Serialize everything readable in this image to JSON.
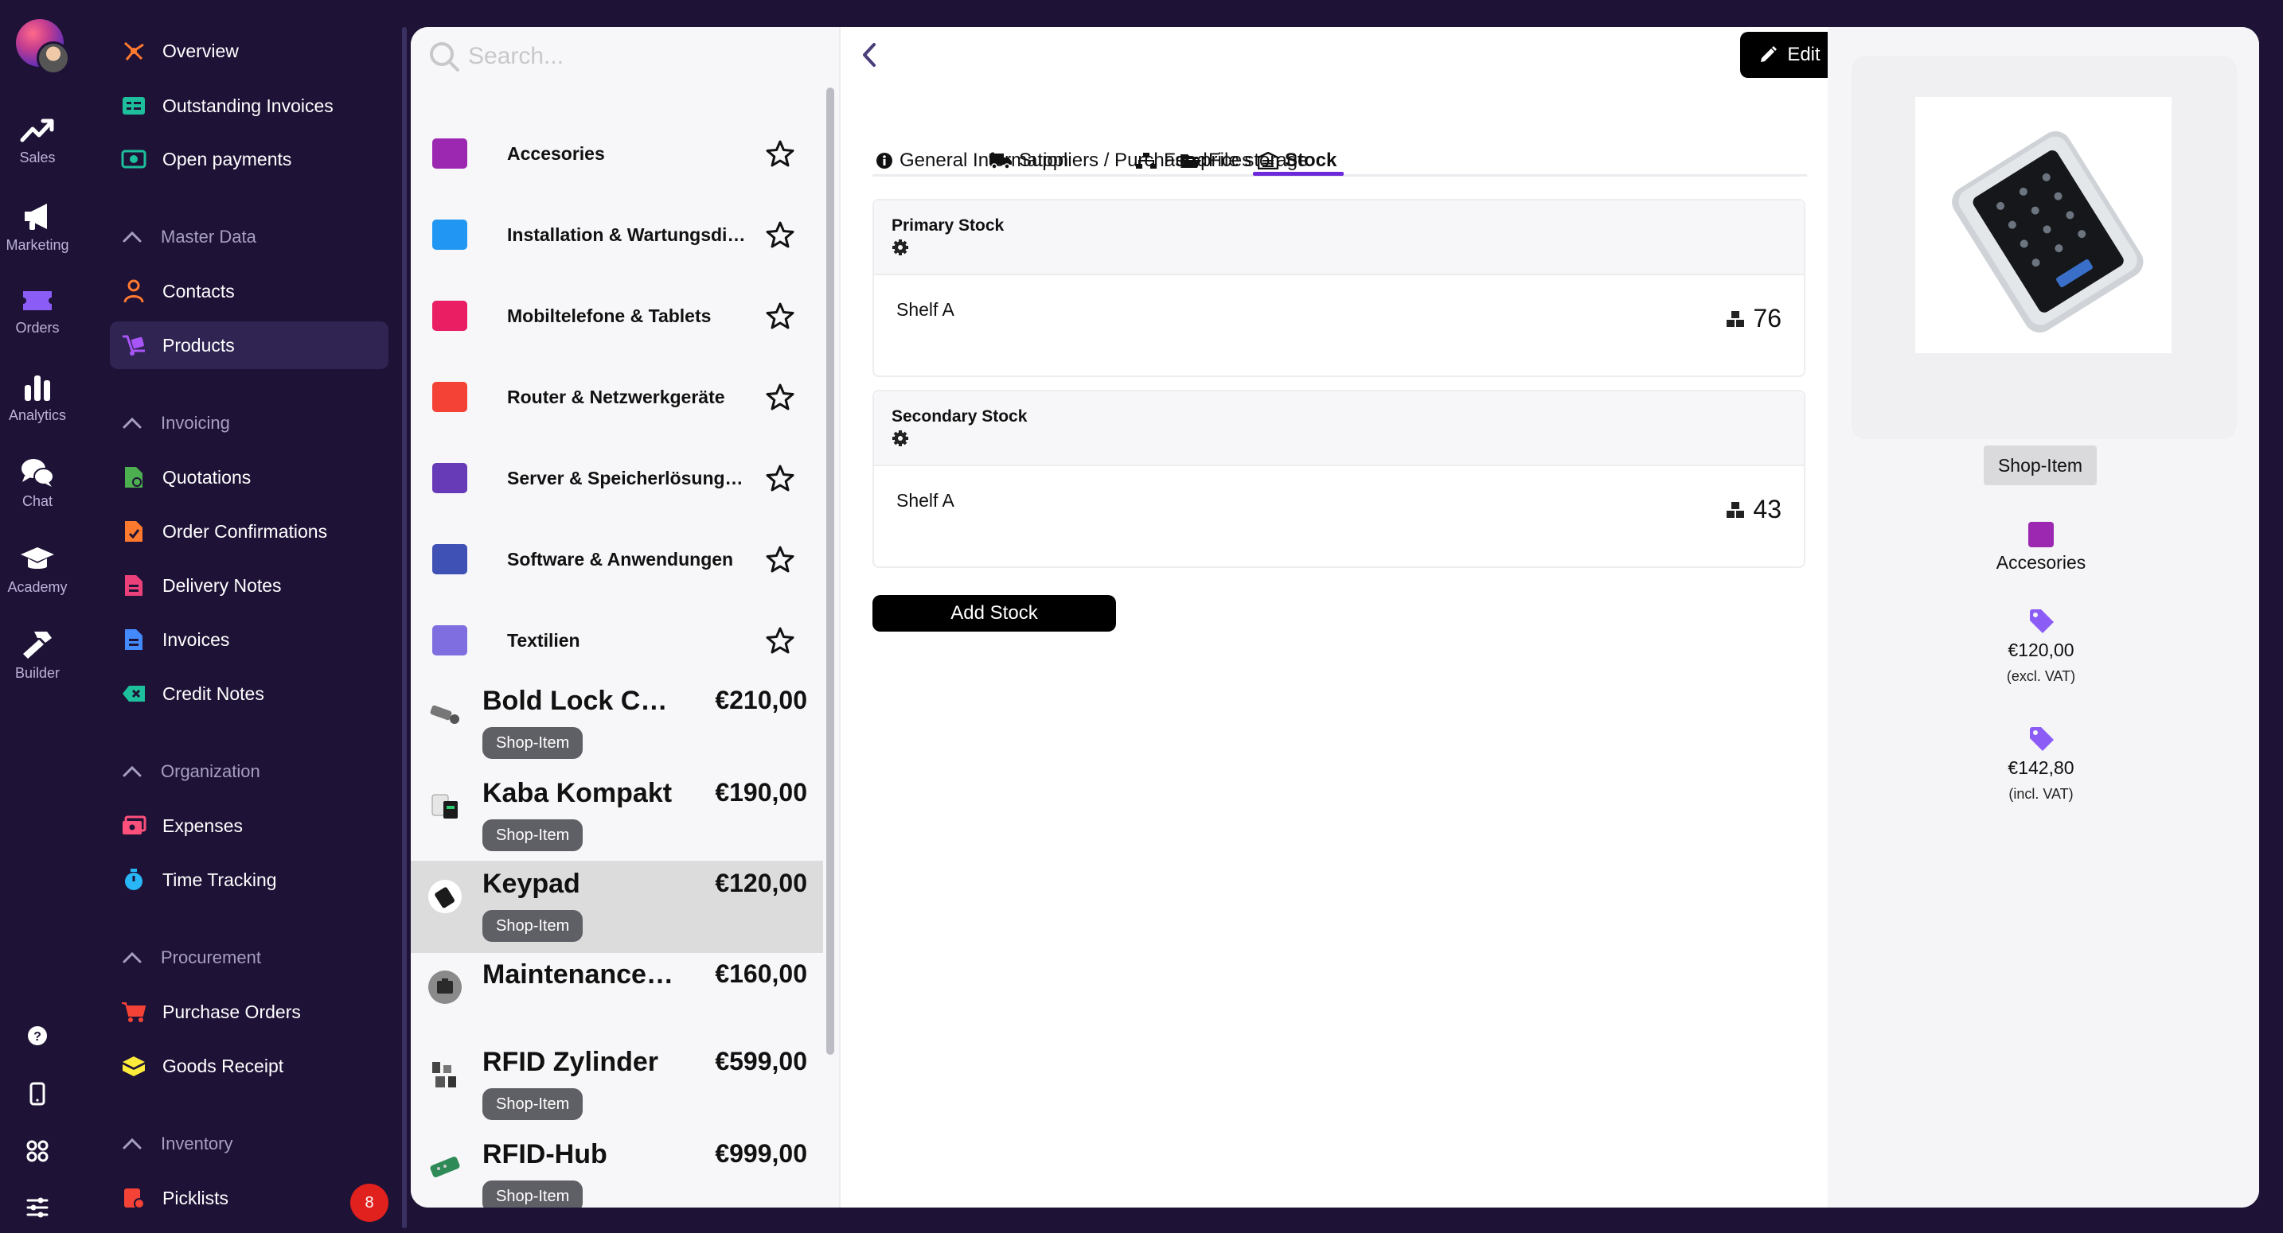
{
  "rail": {
    "items": [
      {
        "label": "Sales",
        "icon": "trend-up-icon"
      },
      {
        "label": "Marketing",
        "icon": "megaphone-icon"
      },
      {
        "label": "Orders",
        "icon": "ticket-icon"
      },
      {
        "label": "Analytics",
        "icon": "bar-chart-icon"
      },
      {
        "label": "Chat",
        "icon": "chat-bubbles-icon"
      },
      {
        "label": "Academy",
        "icon": "graduation-cap-icon"
      },
      {
        "label": "Builder",
        "icon": "hammer-icon"
      }
    ],
    "bottom_icons": [
      "help-icon",
      "mobile-icon",
      "apps-grid-icon",
      "sliders-icon"
    ]
  },
  "nav": {
    "overview": "Overview",
    "outstanding_invoices": "Outstanding Invoices",
    "open_payments": "Open payments",
    "master_data": "Master Data",
    "contacts": "Contacts",
    "products": "Products",
    "invoicing": "Invoicing",
    "quotations": "Quotations",
    "order_confirmations": "Order Confirmations",
    "delivery_notes": "Delivery Notes",
    "invoices": "Invoices",
    "credit_notes": "Credit Notes",
    "organization": "Organization",
    "expenses": "Expenses",
    "time_tracking": "Time Tracking",
    "procurement": "Procurement",
    "purchase_orders": "Purchase Orders",
    "goods_receipt": "Goods Receipt",
    "inventory": "Inventory",
    "picklists": "Picklists",
    "picklists_count": "8"
  },
  "list": {
    "search_placeholder": "Search...",
    "categories": [
      {
        "name": "Accesories",
        "color": "#9c27b0"
      },
      {
        "name": "Installation & Wartungsdienste",
        "color": "#2196f3"
      },
      {
        "name": "Mobiltelefone & Tablets",
        "color": "#e91e63"
      },
      {
        "name": "Router & Netzwerkgeräte",
        "color": "#f44336"
      },
      {
        "name": "Server & Speicherlösungen",
        "color": "#673ab7"
      },
      {
        "name": "Software & Anwendungen",
        "color": "#3f51b5"
      },
      {
        "name": "Textilien",
        "color": "#7e6ee0"
      }
    ],
    "products": [
      {
        "name": "Bold Lock Cylinder",
        "price": "€210,00",
        "tag": "Shop-Item"
      },
      {
        "name": "Kaba Kompakt",
        "price": "€190,00",
        "tag": "Shop-Item"
      },
      {
        "name": "Keypad",
        "price": "€120,00",
        "tag": "Shop-Item"
      },
      {
        "name": "Maintenance Service",
        "price": "€160,00",
        "tag": ""
      },
      {
        "name": "RFID Zylinder",
        "price": "€599,00",
        "tag": "Shop-Item"
      },
      {
        "name": "RFID-Hub",
        "price": "€999,00",
        "tag": "Shop-Item"
      }
    ]
  },
  "detail": {
    "edit_label": "Edit",
    "tabs": [
      {
        "label": "General Information",
        "icon": "info-icon"
      },
      {
        "label": "Suppliers / Purchase prices",
        "icon": "truck-icon"
      },
      {
        "label": "Feed",
        "icon": "sitemap-icon"
      },
      {
        "label": "File storage",
        "icon": "folder-open-icon"
      },
      {
        "label": "Stock",
        "icon": "warehouse-icon"
      }
    ],
    "active_tab": "Stock",
    "stocks": [
      {
        "title": "Primary Stock",
        "shelf": "Shelf A",
        "qty": "76"
      },
      {
        "title": "Secondary Stock",
        "shelf": "Shelf A",
        "qty": "43"
      }
    ],
    "add_stock_label": "Add Stock"
  },
  "info": {
    "tag": "Shop-Item",
    "category": "Accesories",
    "category_color": "#9c27b0",
    "price_net": "€120,00",
    "price_net_note": "(excl. VAT)",
    "price_gross": "€142,80",
    "price_gross_note": "(incl. VAT)",
    "accent_color": "#8b5cf6"
  }
}
